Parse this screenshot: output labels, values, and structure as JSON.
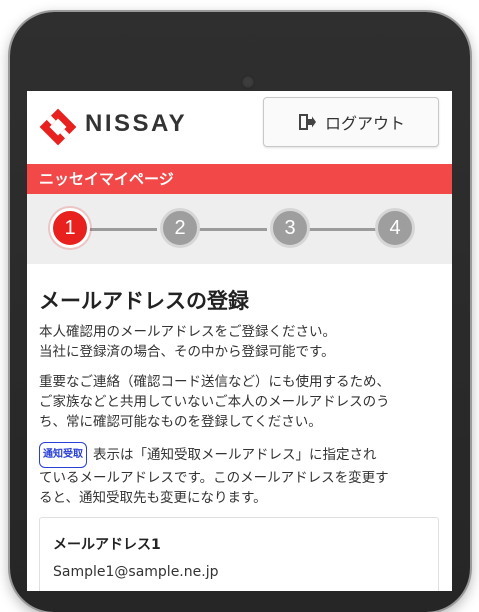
{
  "header": {
    "brand": "NISSAY",
    "logout_label": "ログアウト"
  },
  "banner": {
    "title": "ニッセイマイページ"
  },
  "steps": [
    {
      "label": "1",
      "active": true
    },
    {
      "label": "2",
      "active": false
    },
    {
      "label": "3",
      "active": false
    },
    {
      "label": "4",
      "active": false
    }
  ],
  "main": {
    "title": "メールアドレスの登録",
    "para1_line1": "本人確認用のメールアドレスをご登録ください。",
    "para1_line2": "当社に登録済の場合、その中から登録可能です。",
    "para2_line1": "重要なご連絡（確認コード送信など）にも使用するため、",
    "para2_line2": "ご家族などと共用していないご本人のメールアドレスのう",
    "para2_line3": "ち、常に確認可能なものを登録してください。",
    "badge": "通知受取",
    "para3_line1": "表示は「通知受取メールアドレス」に指定され",
    "para3_line2": "ているメールアドレスです。このメールアドレスを変更す",
    "para3_line3": "ると、通知受取先も変更になります。"
  },
  "email_card": {
    "title": "メールアドレス1",
    "value": "Sample1@sample.ne.jp"
  },
  "colors": {
    "accent_red": "#f24848",
    "step_active": "#e8201e",
    "step_inactive": "#9e9e9e",
    "badge_blue": "#2a3fd6"
  },
  "icons": {
    "logo": "nissay-logo-icon",
    "logout": "logout-door-icon"
  }
}
